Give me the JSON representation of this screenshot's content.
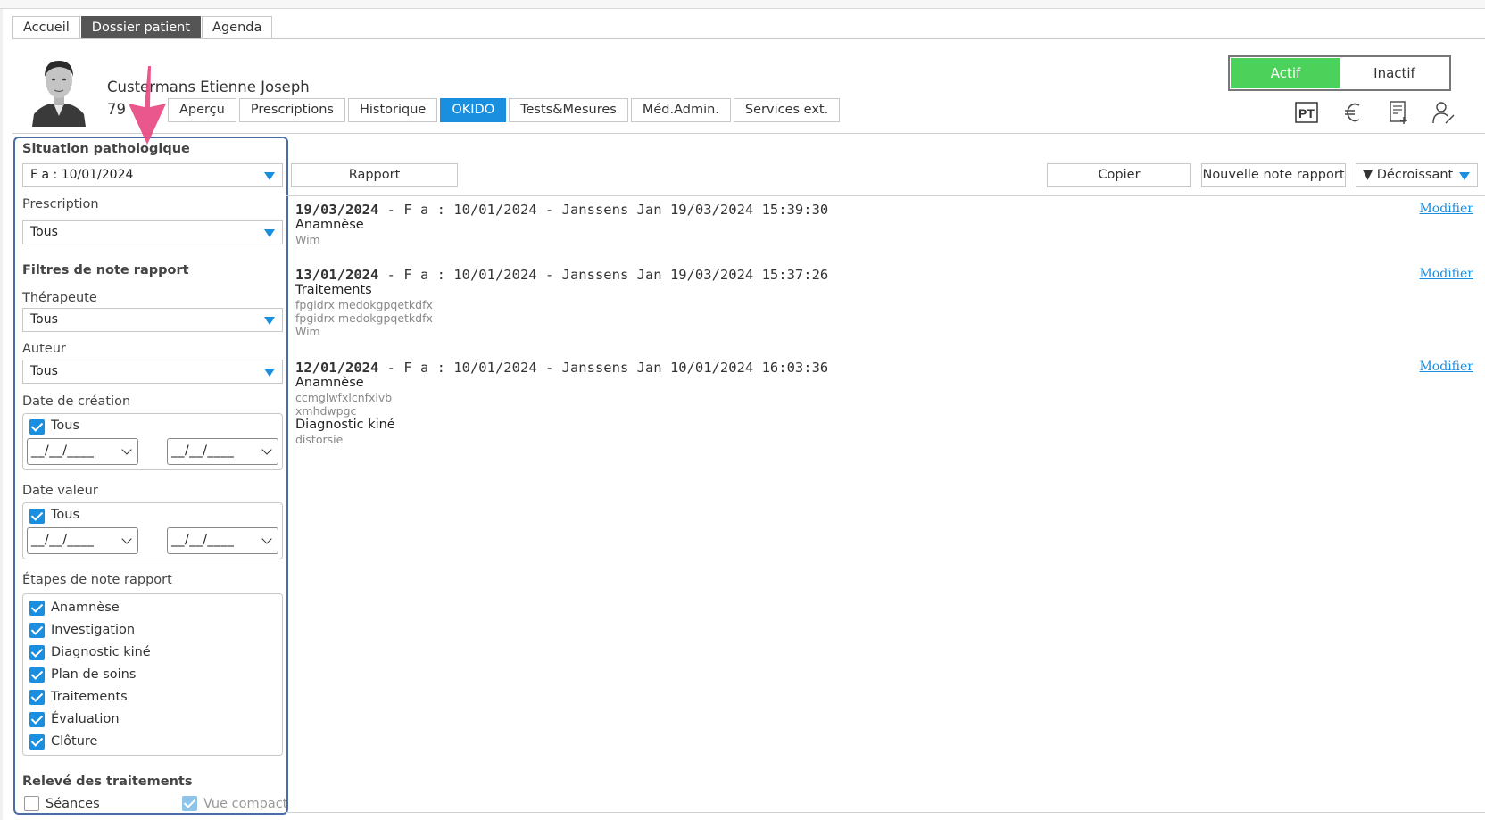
{
  "main_tabs": [
    {
      "label": "Accueil",
      "active": false
    },
    {
      "label": "Dossier patient",
      "active": true
    },
    {
      "label": "Agenda",
      "active": false
    }
  ],
  "patient": {
    "name": "Custermans Etienne Joseph",
    "id": "79"
  },
  "sub_tabs": [
    {
      "label": "Aperçu",
      "active": false
    },
    {
      "label": "Prescriptions",
      "active": false
    },
    {
      "label": "Historique",
      "active": false
    },
    {
      "label": "OKIDO",
      "active": true
    },
    {
      "label": "Tests&Mesures",
      "active": false
    },
    {
      "label": "Méd.Admin.",
      "active": false
    },
    {
      "label": "Services ext.",
      "active": false
    }
  ],
  "status": {
    "active_label": "Actif",
    "inactive_label": "Inactif",
    "current": "Actif",
    "active_color": "#4cd15a"
  },
  "tools": [
    {
      "icon": "pt-icon",
      "label": "PT"
    },
    {
      "icon": "euro-icon",
      "label": "€"
    },
    {
      "icon": "document-add-icon"
    },
    {
      "icon": "user-edit-icon"
    }
  ],
  "panel": {
    "situation_title": "Situation pathologique",
    "situation_value": "F a : 10/01/2024",
    "prescription_label": "Prescription",
    "prescription_value": "Tous",
    "filters_title": "Filtres de note rapport",
    "therapist_label": "Thérapeute",
    "therapist_value": "Tous",
    "author_label": "Auteur",
    "author_value": "Tous",
    "creation_label": "Date de création",
    "creation_all_label": "Tous",
    "creation_from": "__/__/____",
    "creation_to": "__/__/____",
    "value_label": "Date valeur",
    "value_all_label": "Tous",
    "value_from": "__/__/____",
    "value_to": "__/__/____",
    "steps_label": "Étapes de note rapport",
    "steps": [
      "Anamnèse",
      "Investigation",
      "Diagnostic kiné",
      "Plan de soins",
      "Traitements",
      "Évaluation",
      "Clôture"
    ],
    "treatments_title": "Relevé des traitements",
    "sessions_label": "Séances",
    "compact_label": "Vue compact"
  },
  "toolbar": {
    "report_label": "Rapport",
    "copy_label": "Copier",
    "new_note_label": "Nouvelle note rapport",
    "sort_label": "▼ Décroissant"
  },
  "notes": [
    {
      "date": "19/03/2024",
      "meta": " - F a : 10/01/2024 - Janssens Jan 19/03/2024 15:39:30",
      "modify": "Modifier",
      "sections": [
        {
          "title": "Anamnèse",
          "lines": [
            "Wim"
          ]
        }
      ]
    },
    {
      "date": "13/01/2024",
      "meta": " - F a : 10/01/2024 - Janssens Jan 19/03/2024 15:37:26",
      "modify": "Modifier",
      "sections": [
        {
          "title": "Traitements",
          "lines": [
            "fpgidrx medokgpqetkdfx",
            "fpgidrx medokgpqetkdfx",
            "Wim"
          ]
        }
      ]
    },
    {
      "date": "12/01/2024",
      "meta": " - F a : 10/01/2024 - Janssens Jan 10/01/2024 16:03:36",
      "modify": "Modifier",
      "sections": [
        {
          "title": "Anamnèse",
          "lines": [
            "ccmglwfxlcnfxlvb",
            "xmhdwpgc"
          ]
        },
        {
          "title": "Diagnostic kiné",
          "lines": [
            "distorsie"
          ]
        }
      ]
    }
  ],
  "colors": {
    "accent": "#1a8fe0",
    "panel_border": "#4a6da7",
    "arrow": "#e8457f"
  }
}
